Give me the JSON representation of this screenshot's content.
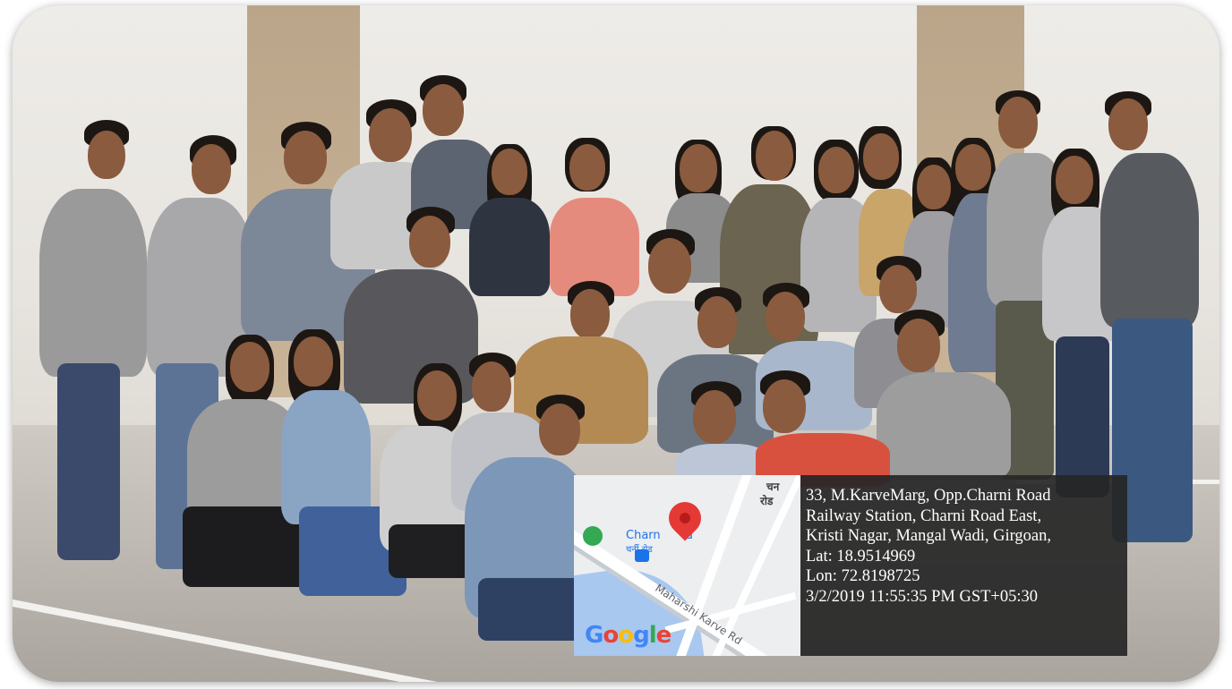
{
  "photo": {
    "description_icon": "group-photo-icon",
    "colors": {
      "wall": "#eceae6",
      "pillar": "#c2ab8f",
      "ground": "#c3beb7"
    }
  },
  "map": {
    "place_label_en": "Charni Road",
    "place_label_en_visible": "Charn",
    "place_label_en_suffix": "d",
    "place_label_hi": "चर्नी रोड",
    "top_right_label_hi_1": "चन",
    "top_right_label_hi_2": "रोड",
    "road_label": "Maharshi Karve Rd",
    "logo_text": "Google",
    "logo_colors": [
      "#4285F4",
      "#EA4335",
      "#FBBC05",
      "#4285F4",
      "#34A853",
      "#EA4335"
    ],
    "pin_icon": "location-pin-icon",
    "park_icon": "park-icon",
    "metro_icon": "train-station-icon"
  },
  "geo": {
    "address_line1": "33, M.KarveMarg, Opp.Charni Road",
    "address_line2": "Railway Station, Charni Road East,",
    "address_line3": "Kristi Nagar, Mangal Wadi, Girgoan,",
    "lat": "Lat: 18.9514969",
    "lon": "Lon: 72.8198725",
    "timestamp": "3/2/2019 11:55:35 PM GST+05:30"
  }
}
